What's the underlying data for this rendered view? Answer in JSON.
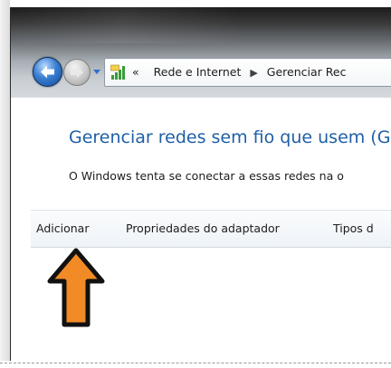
{
  "address_bar": {
    "overflow_label": "«",
    "breadcrumb": [
      "Rede e Internet",
      "Gerenciar Rec"
    ]
  },
  "main": {
    "title": "Gerenciar redes sem fio que usem (G",
    "description": "O Windows tenta se conectar a essas redes na o"
  },
  "toolbar": {
    "items": [
      "Adicionar",
      "Propriedades do adaptador",
      "Tipos d"
    ]
  },
  "colors": {
    "title_blue": "#1f5fa6",
    "callout_arrow": "#f28b25"
  },
  "icons": [
    "back-arrow-icon",
    "forward-arrow-icon",
    "history-dropdown-icon",
    "network-icon",
    "breadcrumb-chevron-icon",
    "callout-arrow-icon"
  ]
}
